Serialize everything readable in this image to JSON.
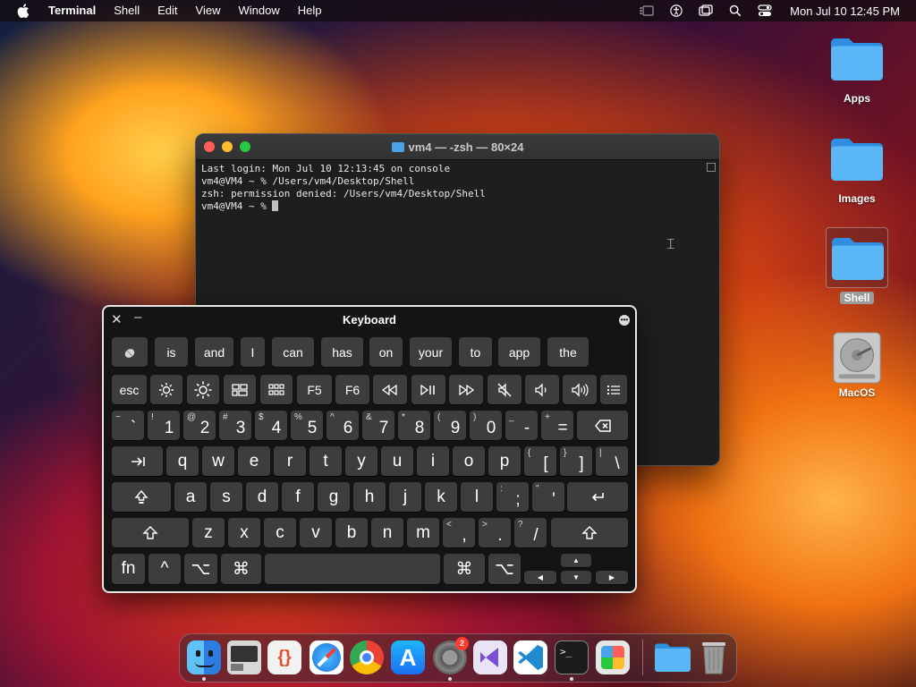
{
  "menubar": {
    "app_name": "Terminal",
    "items": [
      "Shell",
      "Edit",
      "View",
      "Window",
      "Help"
    ],
    "clock": "Mon Jul 10  12:45 PM",
    "status_icons": [
      "stage-manager-icon",
      "accessibility-icon",
      "screen-mirroring-icon",
      "spotlight-search-icon",
      "control-center-icon"
    ]
  },
  "desktop": {
    "icons": [
      {
        "label": "Apps",
        "type": "folder"
      },
      {
        "label": "Images",
        "type": "folder"
      },
      {
        "label": "Shell",
        "type": "folder",
        "selected": true
      },
      {
        "label": "MacOS",
        "type": "disk"
      }
    ]
  },
  "terminal": {
    "title": "vm4 — -zsh — 80×24",
    "lines": [
      "Last login: Mon Jul 10 12:13:45 on console",
      "vm4@VM4 ~ % /Users/vm4/Desktop/Shell",
      "zsh: permission denied: /Users/vm4/Desktop/Shell",
      "vm4@VM4 ~ % "
    ]
  },
  "keyboard": {
    "title": "Keyboard",
    "suggestions": [
      "is",
      "and",
      "I",
      "can",
      "has",
      "on",
      "your",
      "to",
      "app",
      "the"
    ],
    "function_keys": {
      "esc": "esc",
      "f5": "F5",
      "f6": "F6"
    },
    "number_row": [
      {
        "sub": "~",
        "main": "`"
      },
      {
        "sub": "!",
        "main": "1"
      },
      {
        "sub": "@",
        "main": "2"
      },
      {
        "sub": "#",
        "main": "3"
      },
      {
        "sub": "$",
        "main": "4"
      },
      {
        "sub": "%",
        "main": "5"
      },
      {
        "sub": "^",
        "main": "6"
      },
      {
        "sub": "&",
        "main": "7"
      },
      {
        "sub": "*",
        "main": "8"
      },
      {
        "sub": "(",
        "main": "9"
      },
      {
        "sub": ")",
        "main": "0"
      },
      {
        "sub": "_",
        "main": "-"
      },
      {
        "sub": "+",
        "main": "="
      }
    ],
    "row_q": [
      "q",
      "w",
      "e",
      "r",
      "t",
      "y",
      "u",
      "i",
      "o",
      "p"
    ],
    "row_q_symbols": [
      {
        "sub": "{",
        "main": "["
      },
      {
        "sub": "}",
        "main": "]"
      },
      {
        "sub": "|",
        "main": "\\"
      }
    ],
    "row_a": [
      "a",
      "s",
      "d",
      "f",
      "g",
      "h",
      "j",
      "k",
      "l"
    ],
    "row_a_symbols": [
      {
        "sub": ":",
        "main": ";"
      },
      {
        "sub": "\"",
        "main": "'"
      }
    ],
    "row_z": [
      "z",
      "x",
      "c",
      "v",
      "b",
      "n",
      "m"
    ],
    "row_z_symbols": [
      {
        "sub": "<",
        "main": ","
      },
      {
        "sub": ">",
        "main": "."
      },
      {
        "sub": "?",
        "main": "/"
      }
    ],
    "bottom": {
      "fn": "fn",
      "control": "^",
      "option": "⌥",
      "command": "⌘"
    }
  },
  "dock": {
    "apps": [
      "finder-icon",
      "system-information-icon",
      "script-editor-icon",
      "safari-icon",
      "chrome-icon",
      "app-store-icon",
      "system-settings-icon",
      "visual-studio-icon",
      "vscode-icon",
      "terminal-icon",
      "launchpad-icon",
      "downloads-folder-icon",
      "trash-icon"
    ],
    "settings_badge": "2"
  },
  "colors": {
    "accent_folder": "#4aa3e8",
    "terminal_bg": "#1e1e1e",
    "key_bg": "#3d3d3d"
  }
}
